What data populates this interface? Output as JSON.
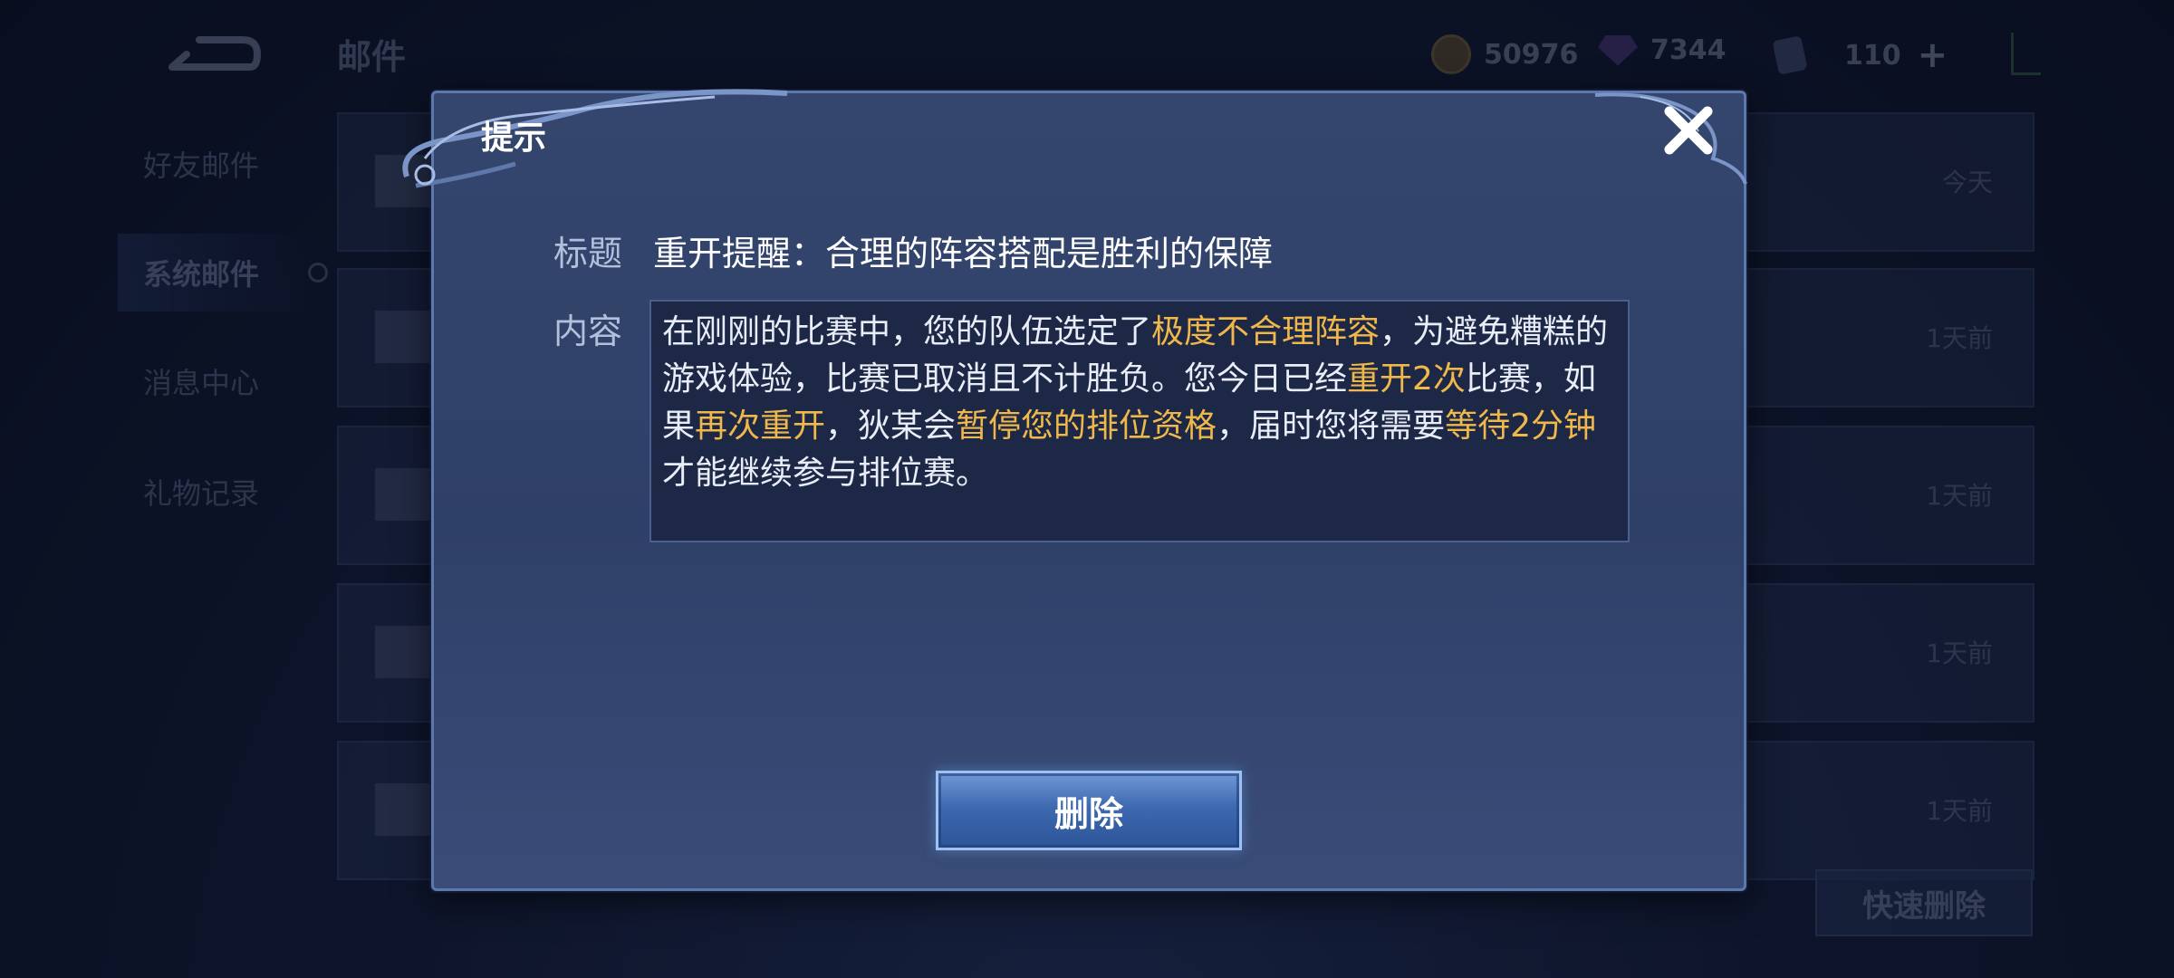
{
  "header": {
    "title": "邮件",
    "gold": "50976",
    "gems": "7344",
    "tickets": "110"
  },
  "sidebar": {
    "items": [
      {
        "label": "好友邮件"
      },
      {
        "label": "系统邮件"
      },
      {
        "label": "消息中心"
      },
      {
        "label": "礼物记录"
      }
    ]
  },
  "mail_list": {
    "rows": [
      {
        "date": "今天"
      },
      {
        "date": "1天前"
      },
      {
        "date": "1天前"
      },
      {
        "date": "1天前"
      },
      {
        "date": "1天前"
      }
    ],
    "quick_delete_label": "快速删除"
  },
  "dialog": {
    "title": "提示",
    "subject_label": "标题",
    "subject": "重开提醒：合理的阵容搭配是胜利的保障",
    "content_label": "内容",
    "content_parts": [
      {
        "text": "在刚刚的比赛中，您的队伍选定了",
        "highlight": false
      },
      {
        "text": "极度不合理阵容",
        "highlight": true
      },
      {
        "text": "，为避免糟糕的游戏体验，比赛已取消且不计胜负。您今日已经",
        "highlight": false
      },
      {
        "text": "重开2次",
        "highlight": true
      },
      {
        "text": "比赛，如果",
        "highlight": false
      },
      {
        "text": "再次重开",
        "highlight": true
      },
      {
        "text": "，狄某会",
        "highlight": false
      },
      {
        "text": "暂停您的排位资格",
        "highlight": true
      },
      {
        "text": "，届时您将需要",
        "highlight": false
      },
      {
        "text": "等待2分钟",
        "highlight": true
      },
      {
        "text": "才能继续参与排位赛。",
        "highlight": false
      }
    ],
    "delete_label": "删除"
  },
  "colors": {
    "highlight": "#f0b84a",
    "accent": "#9cc2f2"
  }
}
